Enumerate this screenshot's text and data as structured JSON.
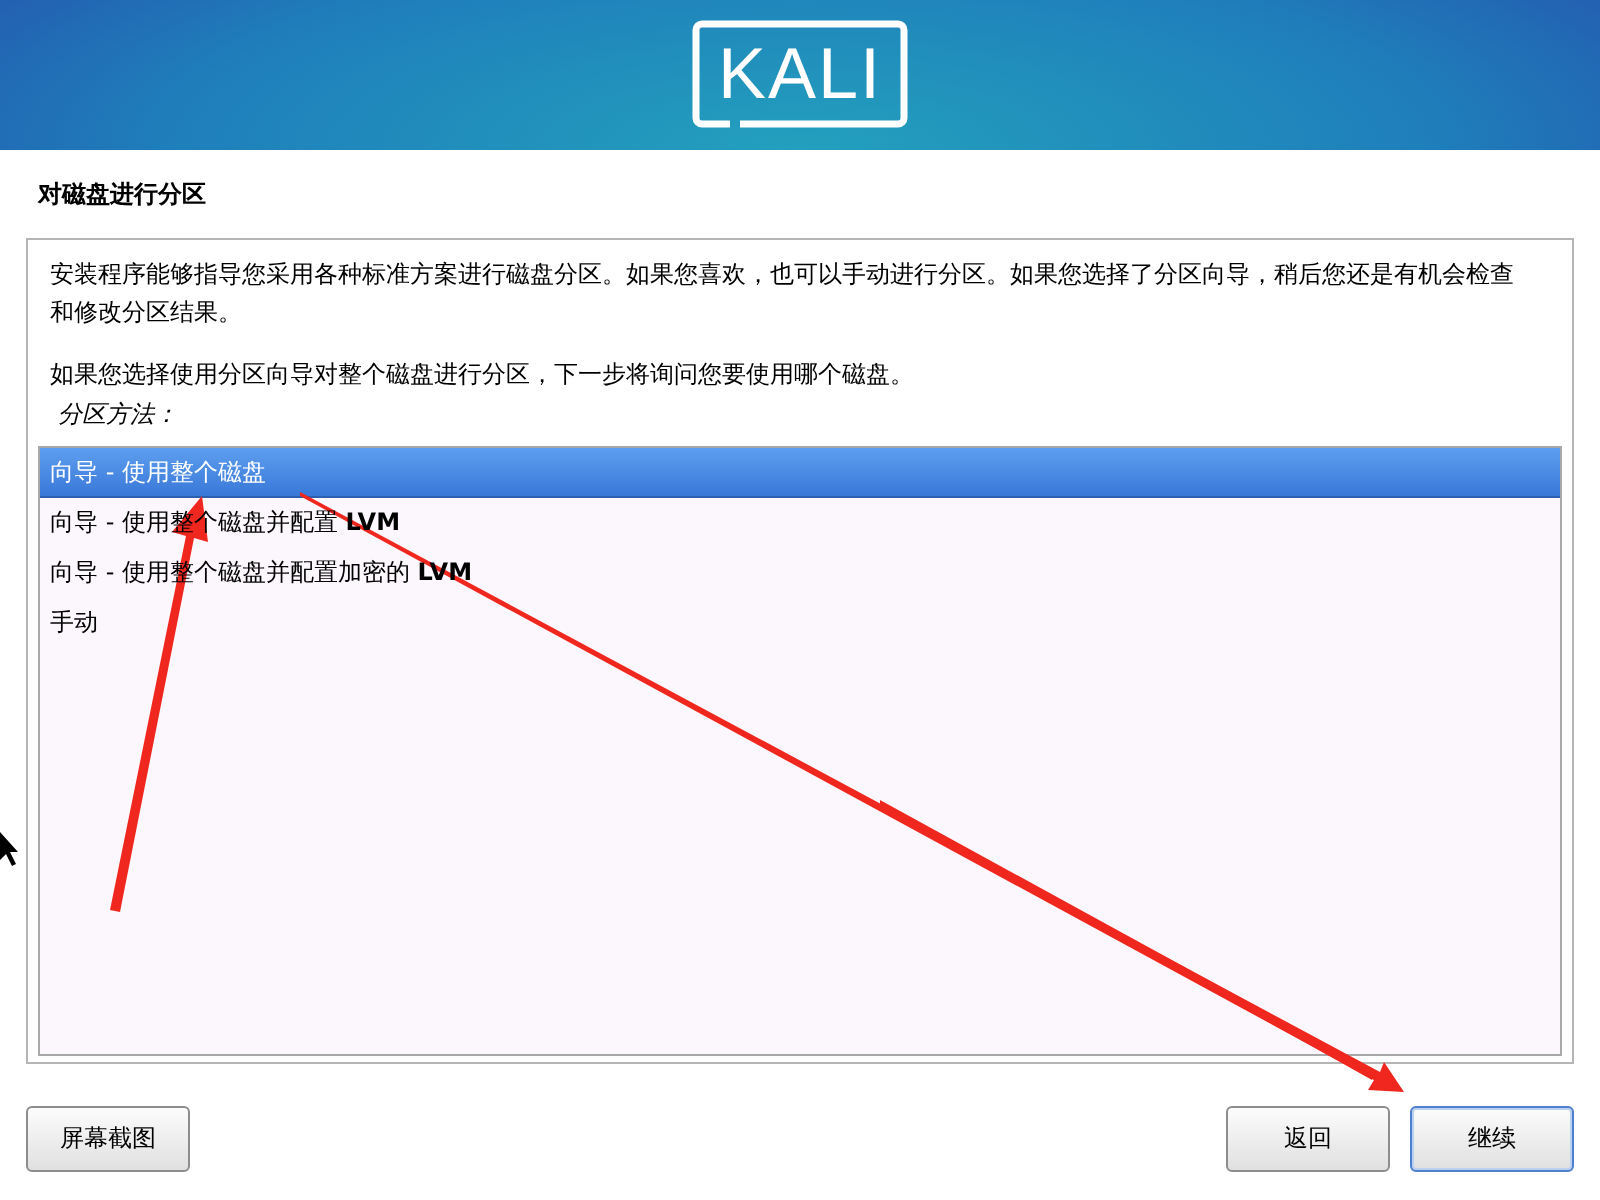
{
  "header": {
    "logo": "KALI"
  },
  "title": "对磁盘进行分区",
  "description": [
    "安装程序能够指导您采用各种标准方案进行磁盘分区。如果您喜欢，也可以手动进行分区。如果您选择了分区向导，稍后您还是有机会检查和修改分区结果。",
    "如果您选择使用分区向导对整个磁盘进行分区，下一步将询问您要使用哪个磁盘。"
  ],
  "list_label": "分区方法：",
  "options": [
    {
      "label": "向导 - 使用整个磁盘",
      "selected": true
    },
    {
      "label": "向导 - 使用整个磁盘并配置 **LVM**",
      "selected": false
    },
    {
      "label": "向导 - 使用整个磁盘并配置加密的 **LVM**",
      "selected": false
    },
    {
      "label": "手动",
      "selected": false
    }
  ],
  "buttons": [
    {
      "label": "屏幕截图",
      "kind": "left",
      "default": false
    },
    {
      "label": "返回",
      "kind": "right",
      "default": false
    },
    {
      "label": "继续",
      "kind": "right",
      "default": true
    }
  ]
}
